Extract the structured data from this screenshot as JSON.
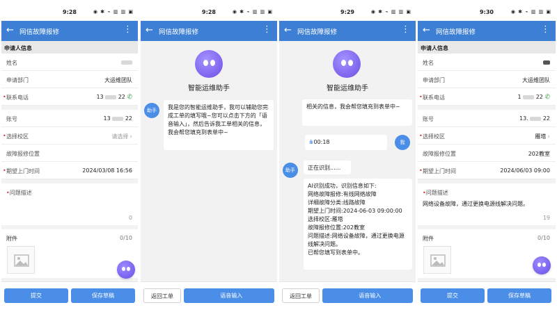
{
  "status": {
    "icons": "◉ ✱ ⌁ ▥ ▥ ▣"
  },
  "panel1": {
    "time": "9:28",
    "title": "网信故障报修",
    "section": "申请人信息",
    "rows": [
      {
        "label": "姓名",
        "value": ""
      },
      {
        "label": "申请部门",
        "value": "大运维团队"
      },
      {
        "label": "联系电话",
        "value_a": "13",
        "value_b": "22"
      },
      {
        "label": "账号",
        "value_a": "13",
        "value_b": "22"
      },
      {
        "label": "选择校区",
        "value": "请选择"
      },
      {
        "label": "故障报修位置",
        "value": ""
      },
      {
        "label": "期望上门时间",
        "value": "2024/03/08 16:56"
      }
    ],
    "desc_label": "问题描述",
    "desc_count": "0",
    "attach_label": "附件",
    "attach_count": "0/10",
    "submit": "提交",
    "draft": "保存草稿"
  },
  "panel2": {
    "time": "9:28",
    "title": "网信故障报修",
    "assistant": "智能运维助手",
    "badge": "助手",
    "greeting": "我是您的智能运维助手，我可以辅助您完成工单的填写哦~您可以点击下方的「语音输入」，然后告诉我工单相关的信息，我会帮您填充到表单中~",
    "back_btn": "返回工单",
    "voice_btn": "语音输入"
  },
  "panel3": {
    "time": "9:29",
    "title": "网信故障报修",
    "assistant": "智能运维助手",
    "tail": "相关的信息，我会帮您填充到表单中~",
    "voice_len": "00:18",
    "me": "我",
    "badge": "助手",
    "recognizing": "正在识别......",
    "result": [
      "AI识别成功，识别信息如下:",
      "网络故障报修:有线网络故障",
      "详细故障分类:线路故障",
      "期望上门时间:2024-06-03 09:00:00",
      "选择校区:雁塔",
      "故障报修位置:202教室",
      "问题描述:网络设备故障，通过更换电源线解决问题。",
      "已帮您填写到表单中。"
    ],
    "back_btn": "返回工单",
    "voice_btn": "语音输入"
  },
  "panel4": {
    "time": "9:30",
    "title": "网信故障报修",
    "section": "申请人信息",
    "rows": [
      {
        "label": "姓名",
        "value": ""
      },
      {
        "label": "申请部门",
        "value": "大运维团队"
      },
      {
        "label": "联系电话",
        "value_a": "1",
        "value_b": "22"
      },
      {
        "label": "账号",
        "value_a": "13.",
        "value_b": "22"
      },
      {
        "label": "选择校区",
        "value": "雁塔"
      },
      {
        "label": "故障报修位置",
        "value": "202教室"
      },
      {
        "label": "期望上门时间",
        "value": "2024/06/03 09:00"
      }
    ],
    "desc_label": "问题描述",
    "desc_text": "网络设备故障，通过更换电源线解决问题。",
    "desc_count": "19",
    "attach_label": "附件",
    "attach_count": "0/10",
    "submit": "提交",
    "draft": "保存草稿"
  }
}
